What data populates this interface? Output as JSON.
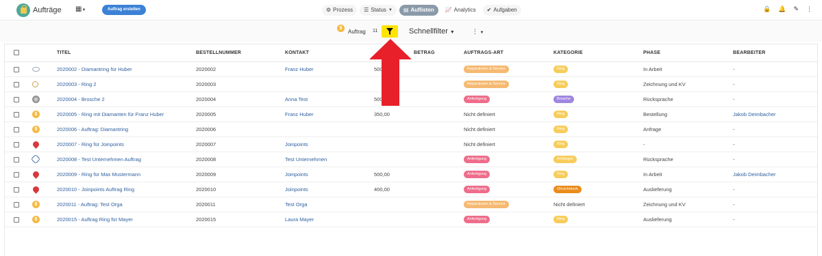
{
  "header": {
    "app_title": "Aufträge",
    "org_icon": "sitemap-icon",
    "create_button": "Auftrag erstellen",
    "tabs": [
      {
        "label": "Prozess",
        "icon": "gear-icon"
      },
      {
        "label": "Status",
        "icon": "list-icon"
      },
      {
        "label": "Auflisten",
        "icon": "table-icon"
      },
      {
        "label": "Analytics",
        "icon": "chart-icon"
      },
      {
        "label": "Aufgaben",
        "icon": "check-circle-icon"
      }
    ],
    "active_tab": "Auflisten"
  },
  "filter_bar": {
    "label": "Auftrag",
    "count": "11",
    "quick_filter": "Schnellfilter",
    "highlight_color": "#ffe400"
  },
  "table": {
    "columns": [
      "TITEL",
      "BESTELLNUMMER",
      "KONTAKT",
      "BETRAG",
      "AUFTRAGS-ART",
      "KATEGORIE",
      "PHASE",
      "BEARBEITER"
    ],
    "rows": [
      {
        "icon": "ring-icon",
        "titel": "2020002 - Diamantring für Huber",
        "nr": "2020002",
        "kontakt": "Franz Huber",
        "betrag": "500",
        "art": "Reparaturen & Service",
        "art_color": "orange",
        "kategorie": "Ring",
        "kat_color": "yellow",
        "phase": "In Arbeit",
        "bearbeiter": "-"
      },
      {
        "icon": "ring-icon",
        "titel": "2020003 - Ring 2",
        "nr": "2020003",
        "kontakt": "",
        "betrag": "",
        "art": "Reparaturen & Service",
        "art_color": "orange",
        "kategorie": "Ring",
        "kat_color": "yellow",
        "phase": "Zeichnung und KV",
        "bearbeiter": "-"
      },
      {
        "icon": "brooch-icon",
        "titel": "2020004 - Brosche 2",
        "nr": "2020004",
        "kontakt": "Anna Test",
        "betrag": "500",
        "art": "Anfertigung",
        "art_color": "pink",
        "kategorie": "Brosche",
        "kat_color": "purple",
        "phase": "Rücksprache",
        "bearbeiter": "-"
      },
      {
        "icon": "coin-icon",
        "titel": "2020005 - Ring mit Diamanten für Franz Huber",
        "nr": "2020005",
        "kontakt": "Franz Huber",
        "betrag": "350,00",
        "art": "Nicht definiert",
        "art_color": "",
        "kategorie": "Ring",
        "kat_color": "yellow",
        "phase": "Bestellung",
        "bearbeiter": "Jakob Deimbacher"
      },
      {
        "icon": "coin-icon",
        "titel": "2020006 - Auftrag: Diamantring",
        "nr": "2020006",
        "kontakt": "",
        "betrag": "",
        "art": "Nicht definiert",
        "art_color": "",
        "kategorie": "Ring",
        "kat_color": "yellow",
        "phase": "Anfrage",
        "bearbeiter": "-"
      },
      {
        "icon": "pin-icon",
        "titel": "2020007 - Ring für Joinpoints",
        "nr": "2020007",
        "kontakt": "Joinpoints",
        "betrag": "",
        "art": "Nicht definiert",
        "art_color": "",
        "kategorie": "Ring",
        "kat_color": "yellow",
        "phase": "-",
        "bearbeiter": "-"
      },
      {
        "icon": "hexagon-icon",
        "titel": "2020008 - Test Unternehmen Auftrag",
        "nr": "2020008",
        "kontakt": "Test Unternehmen",
        "betrag": "",
        "art": "Anfertigung",
        "art_color": "pink",
        "kategorie": "Anhänger",
        "kat_color": "yellow",
        "phase": "Rücksprache",
        "bearbeiter": "-"
      },
      {
        "icon": "pin-icon",
        "titel": "2020009 - Ring für Max Mustermann",
        "nr": "2020009",
        "kontakt": "Joinpoints",
        "betrag": "500,00",
        "art": "Anfertigung",
        "art_color": "pink",
        "kategorie": "Ring",
        "kat_color": "yellow",
        "phase": "In Arbeit",
        "bearbeiter": "Jakob Deimbacher"
      },
      {
        "icon": "pin-icon",
        "titel": "2020010 - Joinpoints Auftrag Ring",
        "nr": "2020010",
        "kontakt": "Joinpoints",
        "betrag": "400,00",
        "art": "Anfertigung",
        "art_color": "pink",
        "kategorie": "Ohrschmuck",
        "kat_color": "darkorange",
        "phase": "Auslieferung",
        "bearbeiter": "-"
      },
      {
        "icon": "coin-icon",
        "titel": "2020011 - Auftrag: Test Orga",
        "nr": "2020011",
        "kontakt": "Test Orga",
        "betrag": "",
        "art": "Reparaturen & Service",
        "art_color": "orange",
        "kategorie": "Nicht definiert",
        "kat_color": "",
        "phase": "Zeichnung und KV",
        "bearbeiter": "-"
      },
      {
        "icon": "coin-icon",
        "titel": "2020015 - Auftrag Ring für Mayer",
        "nr": "2020015",
        "kontakt": "Laura Mayer",
        "betrag": "",
        "art": "Anfertigung",
        "art_color": "pink",
        "kategorie": "Ring",
        "kat_color": "yellow",
        "phase": "Auslieferung",
        "bearbeiter": "-"
      }
    ]
  },
  "overlay": {
    "arrow_color": "#e8202a"
  }
}
